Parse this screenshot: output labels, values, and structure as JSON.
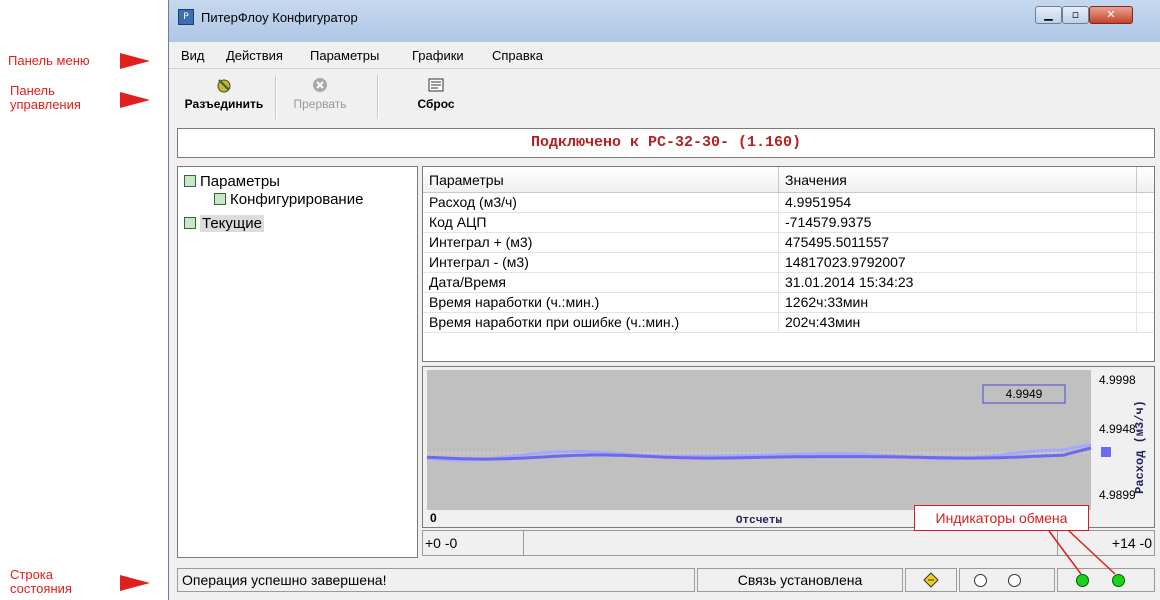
{
  "annotations": {
    "menu_panel": "Панель меню",
    "control_panel_line1": "Панель",
    "control_panel_line2": "управления",
    "status_line1": "Строка",
    "status_line2": "состояния",
    "exchange_indicators": "Индикаторы обмена",
    "accent_color": "#e0201c"
  },
  "window": {
    "title": "ПитерФлоу Конфигуратор",
    "icon": "app-icon",
    "controls": {
      "minimize": "minimize-icon",
      "maximize": "maximize-icon",
      "close": "close-icon"
    }
  },
  "menu": {
    "items": [
      "Вид",
      "Действия",
      "Параметры",
      "Графики",
      "Справка"
    ]
  },
  "toolbar": {
    "disconnect_label": "Разъединить",
    "abort_label": "Прервать",
    "reset_label": "Сброс"
  },
  "connection": {
    "text": "Подключено к PC-32-30-   (1.160)",
    "color": "#b22222"
  },
  "tree": {
    "items": [
      "Параметры",
      "Конфигурирование",
      "Текущие"
    ]
  },
  "table": {
    "headers": [
      "Параметры",
      "Значения"
    ],
    "rows": [
      [
        "Расход (м3/ч)",
        "4.9951954"
      ],
      [
        "Код АЦП",
        "-714579.9375"
      ],
      [
        "Интеграл + (м3)",
        "475495.5011557"
      ],
      [
        "Интеграл - (м3)",
        "14817023.9792007"
      ],
      [
        "Дата/Время",
        "31.01.2014 15:34:23"
      ],
      [
        "Время наработки (ч.:мин.)",
        "1262ч:33мин"
      ],
      [
        "Время наработки при ошибке (ч.:мин.)",
        "202ч:43мин"
      ]
    ]
  },
  "chart": {
    "current_value": "4.9949",
    "y_ticks": [
      "4.9998",
      "4.9948",
      "4.9899"
    ],
    "y_label": "Расход (м3/ч)",
    "x_label": "Отсчеты",
    "x_start": "0",
    "line_color": "#6a6af0"
  },
  "scroll": {
    "left": "+0 -0",
    "right": "+14 -0"
  },
  "status": {
    "message": "Операция успешно завершена!",
    "link": "Связь установлена",
    "leds": [
      "off",
      "off",
      "on",
      "on"
    ]
  }
}
